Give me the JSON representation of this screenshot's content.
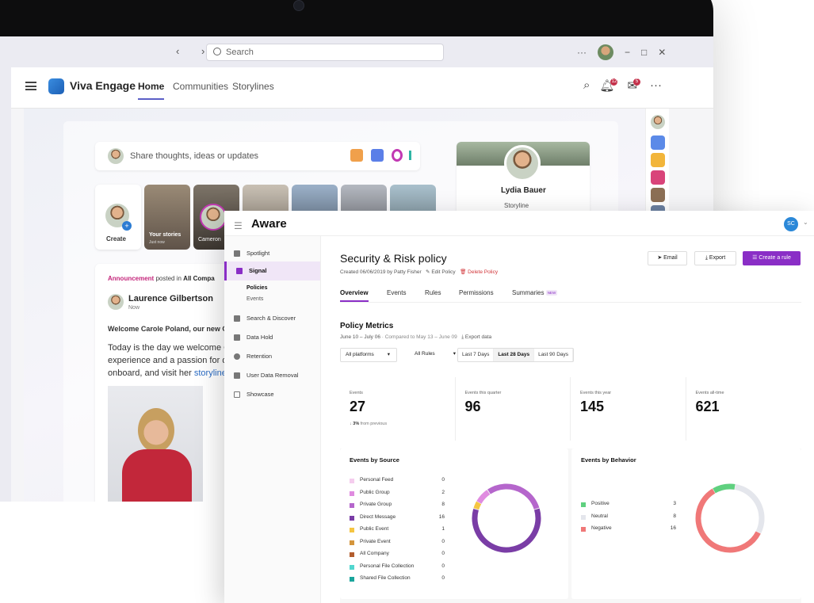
{
  "teams": {
    "search_placeholder": "Search",
    "nav": "‹ ›",
    "title_controls": "···  −  □  ✕"
  },
  "viva": {
    "app_name": "Viva Engage",
    "tabs": [
      "Home",
      "Communities",
      "Storylines"
    ],
    "notification_badges": [
      "12",
      "5"
    ],
    "share_placeholder": "Share thoughts, ideas or updates",
    "stories": [
      "Create",
      "Your stories",
      "Just now",
      "Cameron"
    ],
    "profile": {
      "name": "Lydia Bauer",
      "link": "Storyline"
    },
    "post": {
      "tag": "Announcement",
      "posted_in": "posted in",
      "community": "All Compa",
      "author": "Laurence Gilbertson",
      "time": "Now",
      "headline": "Welcome Carole Poland, our new C",
      "line1": "Today is the day we welcome Ca",
      "line2": "experience and a passion for dri",
      "line3_pre": "onboard, and visit her ",
      "line3_link": "storyline",
      "line3_post": " t"
    }
  },
  "aware": {
    "app_title": "Aware",
    "user_initials": "SC",
    "sidebar": [
      {
        "label": "Spotlight",
        "icon": "spotlight-icon"
      },
      {
        "label": "Signal",
        "icon": "signal-icon",
        "active": true
      },
      {
        "label": "Search & Discover",
        "icon": "search-discover-icon"
      },
      {
        "label": "Data Hold",
        "icon": "data-hold-icon"
      },
      {
        "label": "Retention",
        "icon": "retention-icon"
      },
      {
        "label": "User Data Removal",
        "icon": "user-data-removal-icon"
      },
      {
        "label": "Showcase",
        "icon": "showcase-icon"
      }
    ],
    "sidebar_sub": [
      "Policies",
      "Events"
    ],
    "page_title": "Security & Risk policy",
    "created": "Created 06/06/2019 by Patty Fisher",
    "edit": "Edit Policy",
    "delete": "Delete Policy",
    "buttons": {
      "email": "Email",
      "export": "Export",
      "create": "Create a rule"
    },
    "tabs": [
      "Overview",
      "Events",
      "Rules",
      "Permissions",
      "Summaries"
    ],
    "new_badge": "NEW",
    "section_title": "Policy Metrics",
    "date_range": "June 10 – July 06",
    "compared": "· Compared to May 13 – June 09",
    "export_data": "Export data",
    "filter_platforms": "All platforms",
    "filter_rules": "All Rules",
    "ranges": [
      "Last 7 Days",
      "Last 28 Days",
      "Last 90 Days"
    ],
    "metrics": [
      {
        "label": "Events",
        "value": "27"
      },
      {
        "label": "Events this quarter",
        "value": "96"
      },
      {
        "label": "Events this year",
        "value": "145"
      },
      {
        "label": "Events all-time",
        "value": "621"
      }
    ],
    "change_value": "3%",
    "change_text": "from previous",
    "source_title": "Events by Source",
    "behavior_title": "Events by Behavior"
  },
  "colors": {
    "accent": "#8a2ec6",
    "danger": "#d13438",
    "teams": "#5b5fc7"
  },
  "chart_data": [
    {
      "type": "pie",
      "title": "Events by Source",
      "categories": [
        "Personal Feed",
        "Public Group",
        "Private Group",
        "Direct Message",
        "Public Event",
        "Private Event",
        "All Company",
        "Personal File Collection",
        "Shared File Collection"
      ],
      "values": [
        0,
        2,
        8,
        16,
        1,
        0,
        0,
        0,
        0
      ],
      "colors": [
        "#f5cdee",
        "#e08be0",
        "#b566cc",
        "#7a3da6",
        "#f5c542",
        "#d4953c",
        "#b35d2e",
        "#52d6cf",
        "#1aa59c"
      ]
    },
    {
      "type": "pie",
      "title": "Events by Behavior",
      "categories": [
        "Positive",
        "Neutral",
        "Negative"
      ],
      "values": [
        3,
        8,
        16
      ],
      "colors": [
        "#5fd07f",
        "#e4e6ec",
        "#f07878"
      ]
    }
  ]
}
